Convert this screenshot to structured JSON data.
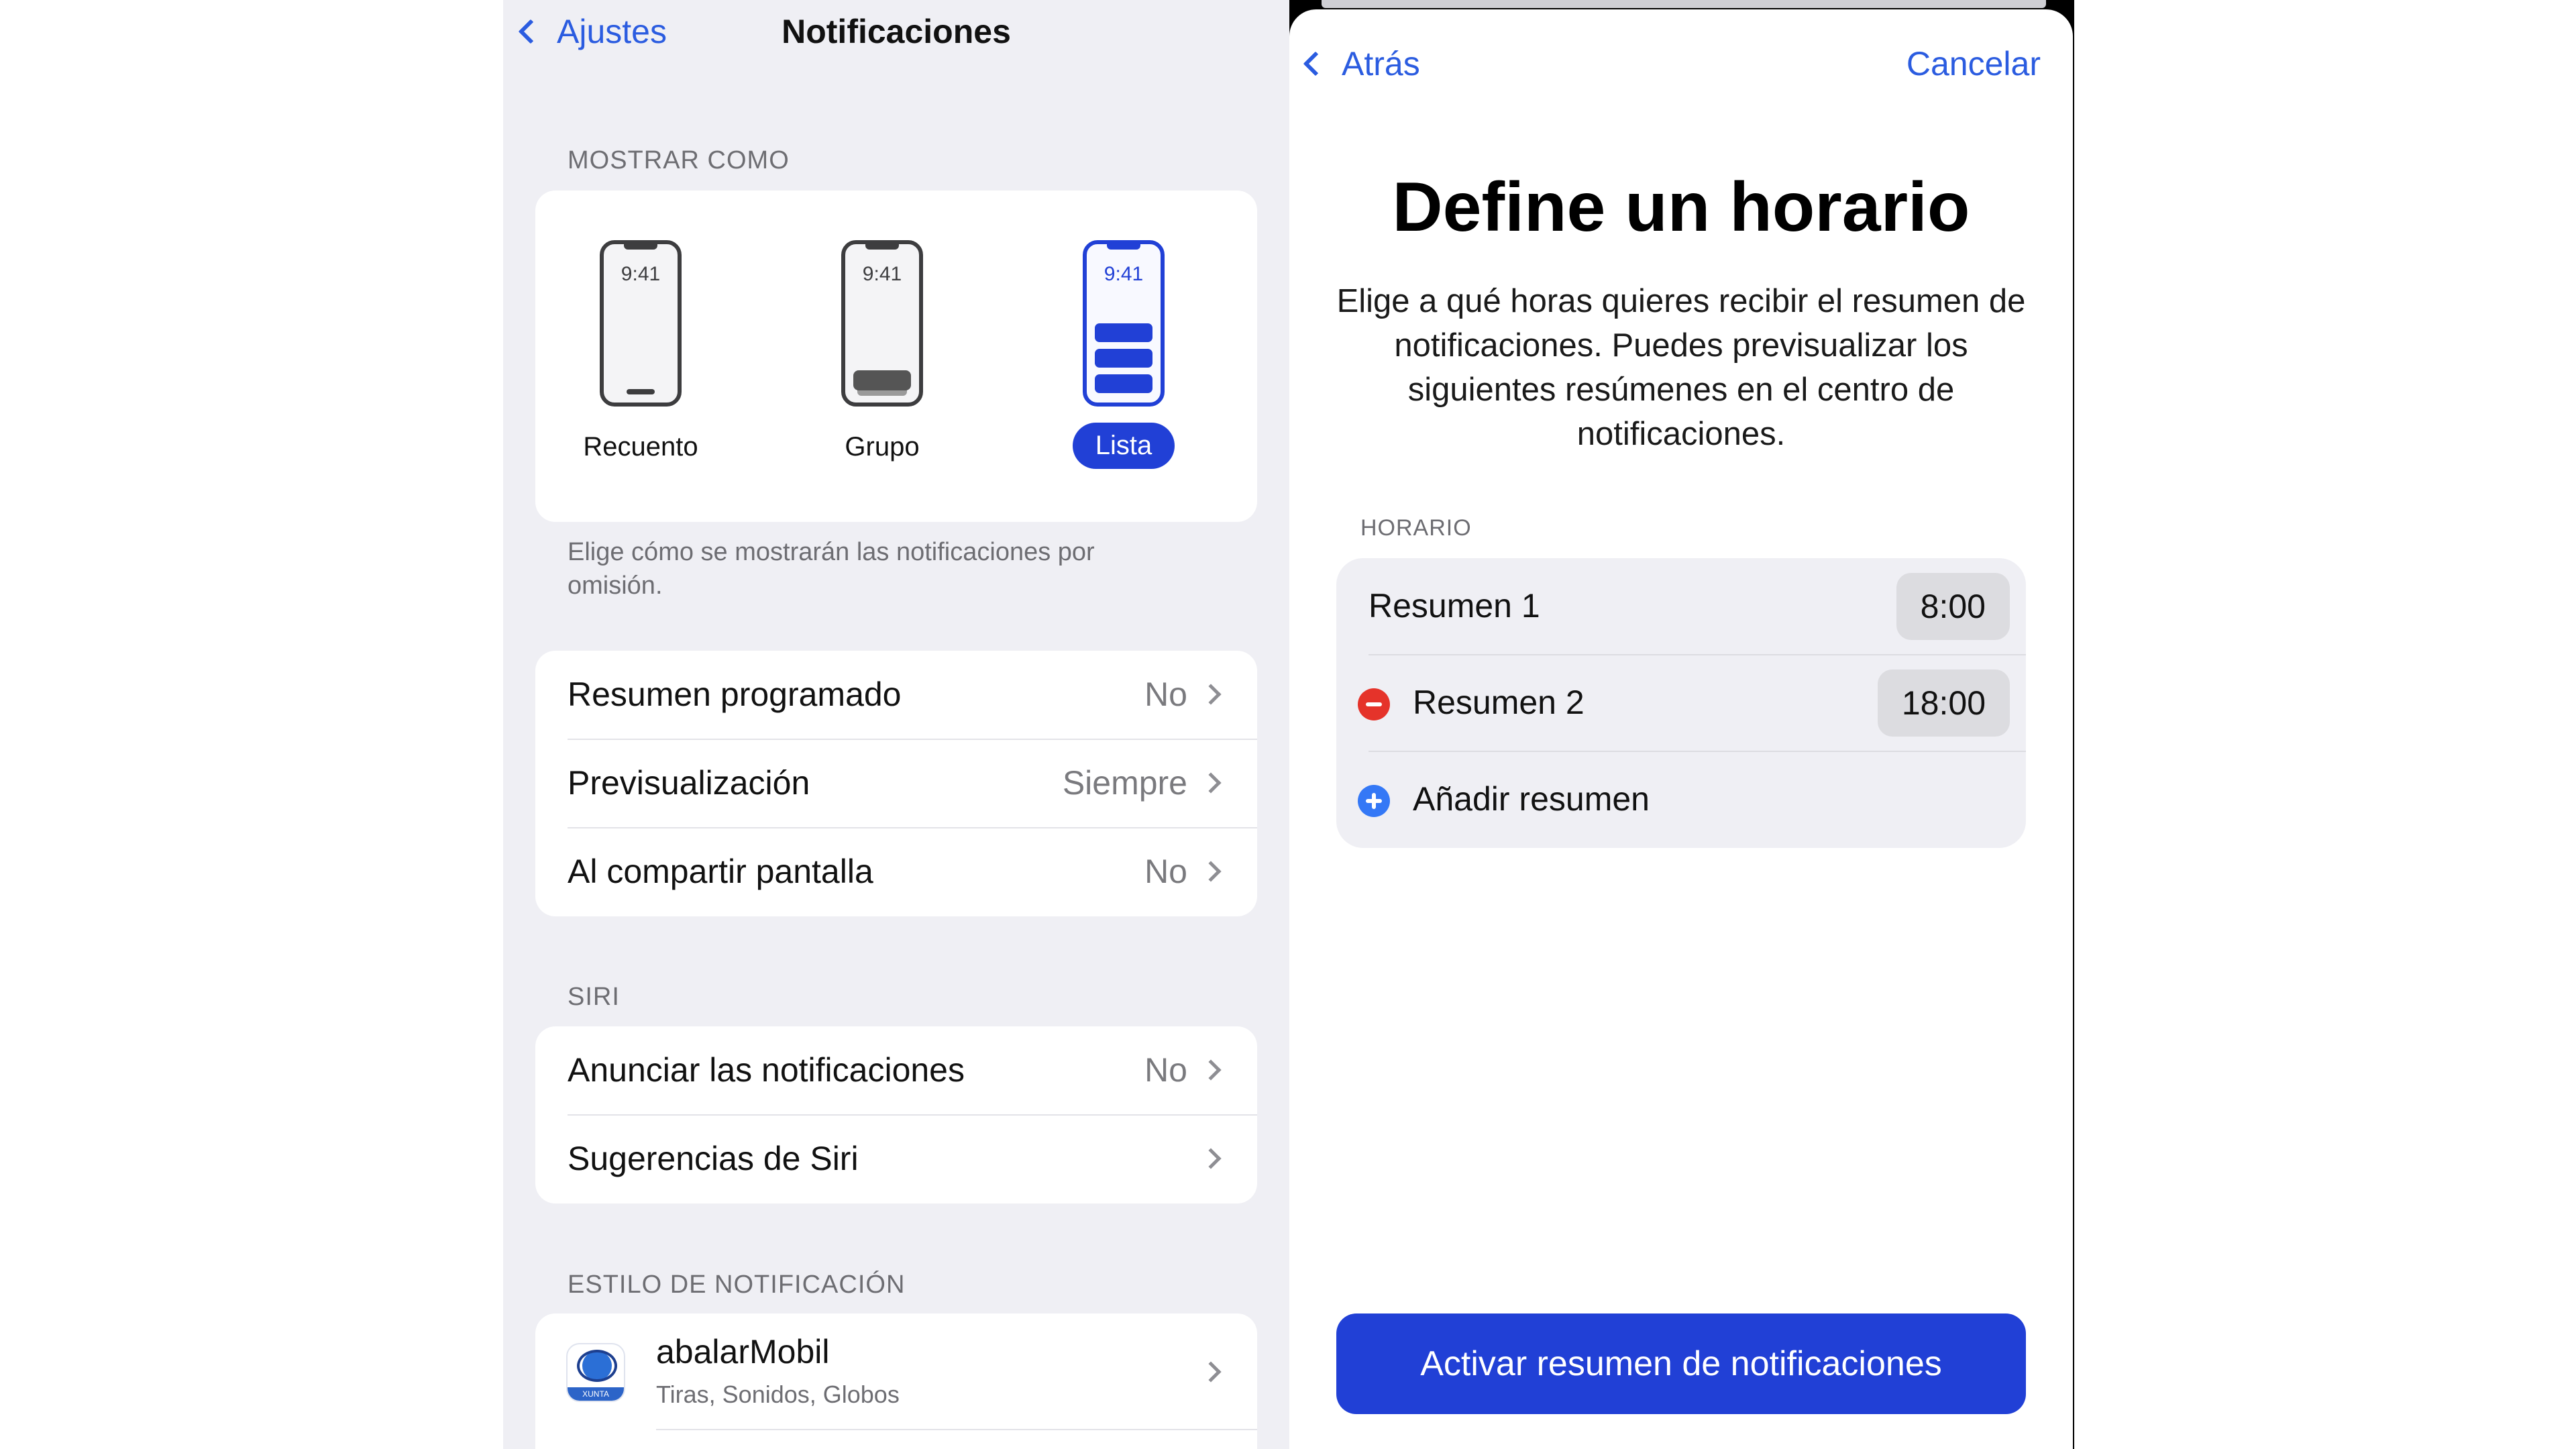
{
  "left": {
    "nav": {
      "back_label": "Ajustes",
      "title": "Notificaciones"
    },
    "show_as": {
      "header": "MOSTRAR COMO",
      "options": [
        {
          "time": "9:41",
          "label": "Recuento"
        },
        {
          "time": "9:41",
          "label": "Grupo"
        },
        {
          "time": "9:41",
          "label": "Lista",
          "selected": true
        }
      ],
      "footer": "Elige cómo se mostrarán las notificaciones por omisión."
    },
    "settings": [
      {
        "label": "Resumen programado",
        "value": "No"
      },
      {
        "label": "Previsualización",
        "value": "Siempre"
      },
      {
        "label": "Al compartir pantalla",
        "value": "No"
      }
    ],
    "siri": {
      "header": "SIRI",
      "rows": [
        {
          "label": "Anunciar las notificaciones",
          "value": "No"
        },
        {
          "label": "Sugerencias de Siri",
          "value": ""
        }
      ]
    },
    "notification_style": {
      "header": "ESTILO DE NOTIFICACIÓN",
      "apps": [
        {
          "name": "abalarMobil",
          "detail": "Tiras, Sonidos, Globos",
          "icon_text": "XUNTA",
          "icon": "abalar-app-icon"
        }
      ]
    }
  },
  "right": {
    "nav": {
      "back_label": "Atrás",
      "cancel_label": "Cancelar"
    },
    "title": "Define un horario",
    "description": "Elige a qué horas quieres recibir el resumen de notificaciones. Puedes previsualizar los siguientes resúmenes en el centro de notificaciones.",
    "schedule": {
      "header": "HORARIO",
      "items": [
        {
          "label": "Resumen 1",
          "time": "8:00"
        },
        {
          "label": "Resumen 2",
          "time": "18:00"
        }
      ],
      "add_label": "Añadir resumen"
    },
    "cta_label": "Activar resumen de notificaciones"
  },
  "colors": {
    "accent": "#2140d6",
    "link": "#2b5ce0",
    "remove": "#e5332a",
    "add": "#3478f6",
    "grouped_bg": "#efeff4"
  }
}
